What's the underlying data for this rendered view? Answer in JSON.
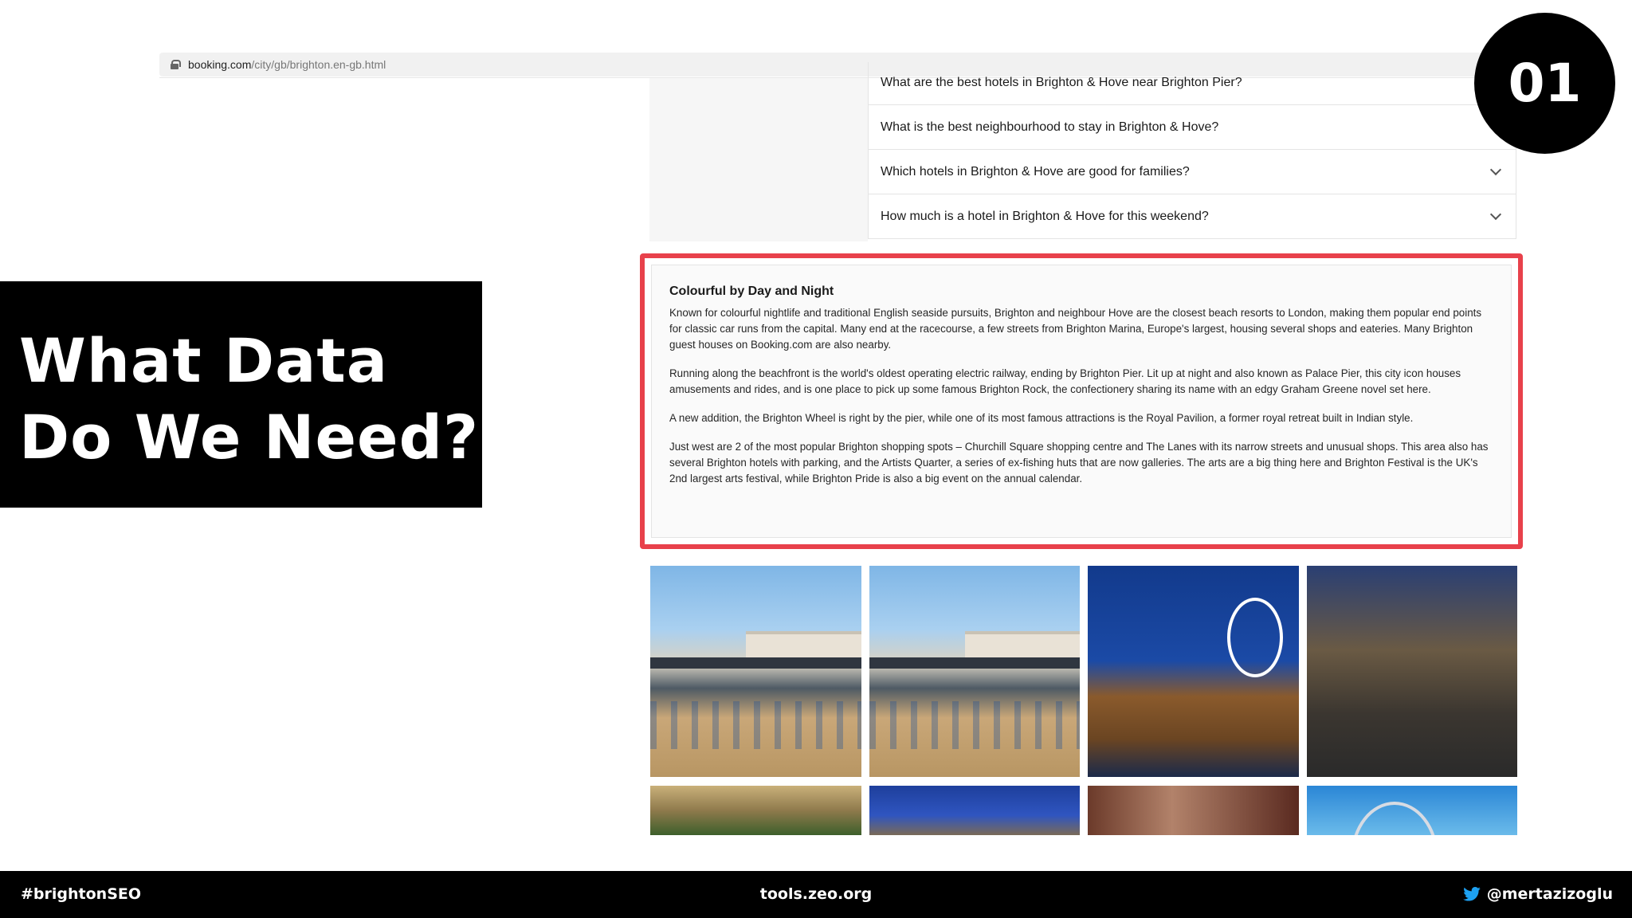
{
  "browser": {
    "url_host": "booking.com",
    "url_path": "/city/gb/brighton.en-gb.html"
  },
  "faq": {
    "items": [
      "What are the best hotels in Brighton & Hove near Brighton Pier?",
      "What is the best neighbourhood to stay in Brighton & Hove?",
      "Which hotels in Brighton & Hove are good for families?",
      "How much is a hotel in Brighton & Hove for this weekend?"
    ]
  },
  "description": {
    "heading": "Colourful by Day and Night",
    "paragraphs": [
      "Known for colourful nightlife and traditional English seaside pursuits, Brighton and neighbour Hove are the closest beach resorts to London, making them popular end points for classic car runs from the capital. Many end at the racecourse, a few streets from Brighton Marina, Europe's largest, housing several shops and eateries. Many Brighton guest houses on Booking.com are also nearby.",
      "Running along the beachfront is the world's oldest operating electric railway, ending by Brighton Pier. Lit up at night and also known as Palace Pier, this city icon houses amusements and rides, and is one place to pick up some famous Brighton Rock, the confectionery sharing its name with an edgy Graham Greene novel set here.",
      "A new addition, the Brighton Wheel is right by the pier, while one of its most famous attractions is the Royal Pavilion, a former royal retreat built in Indian style.",
      "Just west are 2 of the most popular Brighton shopping spots – Churchill Square shopping centre and The Lanes with its narrow streets and unusual shops. This area also has several Brighton hotels with parking, and the Artists Quarter, a series of ex-fishing huts that are now galleries. The arts are a big thing here and Brighton Festival is the UK's 2nd largest arts festival, while Brighton Pride is also a big event on the annual calendar."
    ]
  },
  "slide": {
    "title_line1": "What Data",
    "title_line2": "Do We Need?",
    "number": "01",
    "footer_left": "#brightonSEO",
    "footer_center": "tools.zeo.org",
    "footer_right": "@mertazizoglu"
  },
  "colors": {
    "highlight_border": "#e8414b",
    "slide_black": "#000000",
    "twitter_blue": "#1da1f2"
  },
  "icons": [
    "lock-icon",
    "chevron-down-icon",
    "twitter-bird-icon"
  ]
}
